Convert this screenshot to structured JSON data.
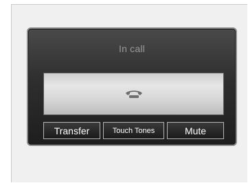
{
  "screen": {
    "title": "In call"
  },
  "call_panel": {
    "icon": "phone-handset-icon"
  },
  "buttons": [
    {
      "label": "Transfer"
    },
    {
      "label": "Touch Tones"
    },
    {
      "label": "Mute"
    }
  ],
  "colors": {
    "screen_bg": "#2e2e2e",
    "panel_bg": "#dcdcdc",
    "button_bg": "#1e1e1e",
    "button_text": "#ffffff",
    "title_text": "#9a9a9a"
  }
}
